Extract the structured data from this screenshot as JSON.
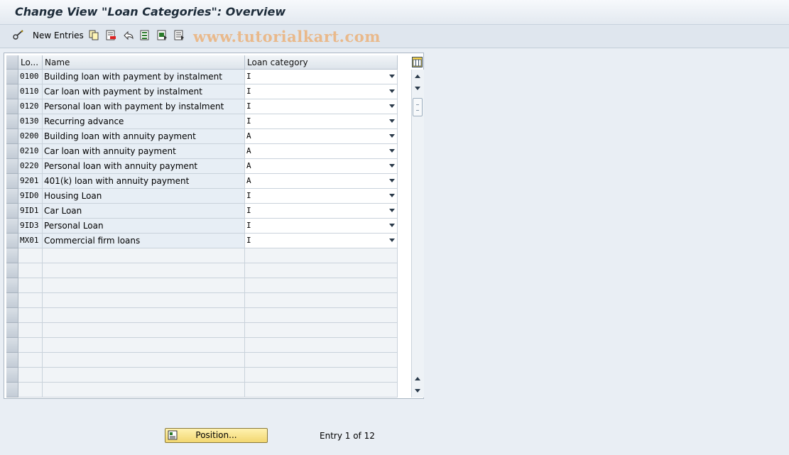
{
  "window": {
    "title": "Change View \"Loan Categories\": Overview"
  },
  "toolbar": {
    "new_entries_label": "New Entries",
    "icons": [
      "glasses-pencil-icon",
      "copy-icon",
      "delete-icon",
      "undo-icon",
      "select-all-icon",
      "select-block-icon",
      "deselect-all-icon"
    ],
    "watermark": "www.tutorialkart.com"
  },
  "table": {
    "columns": [
      "Lo...",
      "Name",
      "Loan category"
    ],
    "rows": [
      {
        "code": "0100",
        "name": "Building loan with payment by instalment",
        "category": "I"
      },
      {
        "code": "0110",
        "name": "Car loan with payment by instalment",
        "category": "I"
      },
      {
        "code": "0120",
        "name": "Personal loan with payment by instalment",
        "category": "I"
      },
      {
        "code": "0130",
        "name": "Recurring advance",
        "category": "I"
      },
      {
        "code": "0200",
        "name": "Building loan with annuity payment",
        "category": "A"
      },
      {
        "code": "0210",
        "name": "Car loan with annuity payment",
        "category": "A"
      },
      {
        "code": "0220",
        "name": "Personal loan with annuity payment",
        "category": "A"
      },
      {
        "code": "9201",
        "name": "401(k) loan with annuity payment",
        "category": "A"
      },
      {
        "code": "9ID0",
        "name": "Housing Loan",
        "category": "I"
      },
      {
        "code": "9ID1",
        "name": "Car Loan",
        "category": "I"
      },
      {
        "code": "9ID3",
        "name": "Personal Loan",
        "category": "I"
      },
      {
        "code": "MX01",
        "name": "Commercial firm loans",
        "category": "I"
      }
    ]
  },
  "footer": {
    "position_label": "Position...",
    "entry_info": "Entry 1 of 12"
  },
  "colors": {
    "title": "#1d2c3a",
    "button": "#f2d770",
    "watermark": "#e9b98b"
  }
}
